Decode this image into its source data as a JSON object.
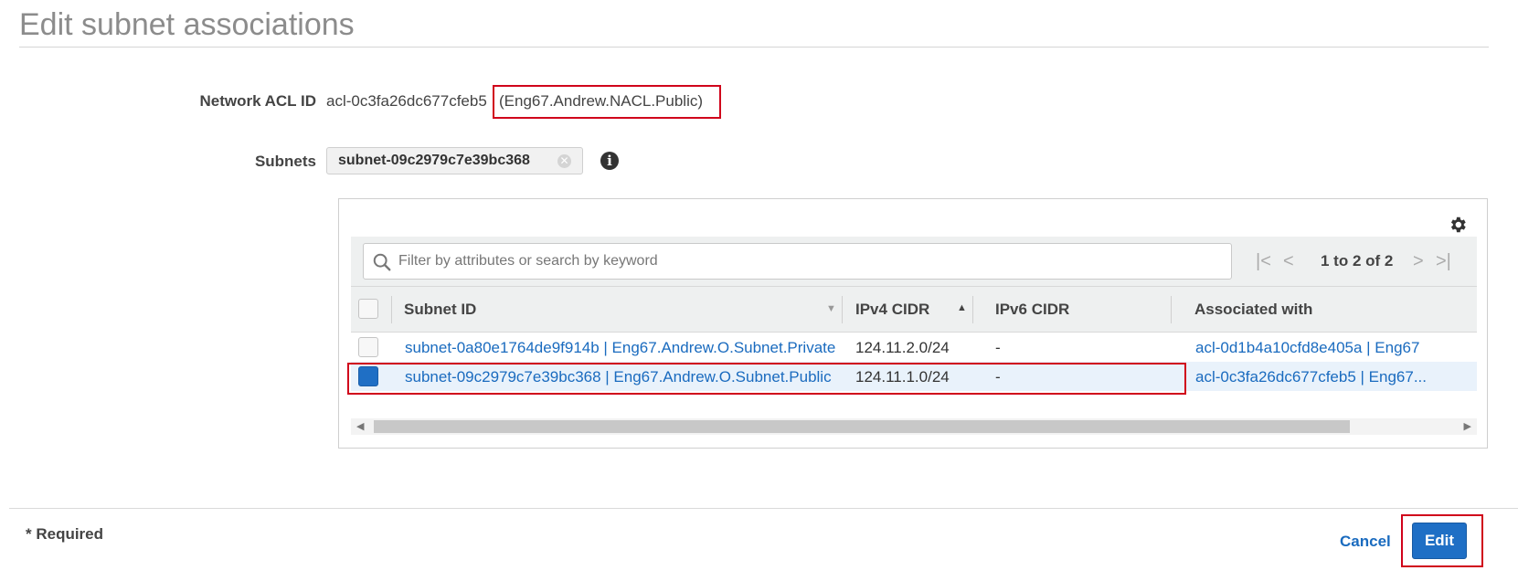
{
  "page": {
    "title": "Edit subnet associations"
  },
  "form": {
    "acl_label": "Network ACL ID",
    "acl_id": "acl-0c3fa26dc677cfeb5",
    "acl_name": "(Eng67.Andrew.NACL.Public)",
    "subnets_label": "Subnets",
    "selected_token": "subnet-09c2979c7e39bc368"
  },
  "table": {
    "search_placeholder": "Filter by attributes or search by keyword",
    "pager_text": "1 to 2 of 2",
    "columns": [
      "Subnet ID",
      "IPv4 CIDR",
      "IPv6 CIDR",
      "Associated with"
    ],
    "rows": [
      {
        "checked": false,
        "subnet": "subnet-0a80e1764de9f914b | Eng67.Andrew.O.Subnet.Private",
        "ipv4": "124.11.2.0/24",
        "ipv6": "-",
        "associated": "acl-0d1b4a10cfd8e405a | Eng67"
      },
      {
        "checked": true,
        "subnet": "subnet-09c2979c7e39bc368 | Eng67.Andrew.O.Subnet.Public",
        "ipv4": "124.11.1.0/24",
        "ipv6": "-",
        "associated": "acl-0c3fa26dc677cfeb5 | Eng67..."
      }
    ]
  },
  "footer": {
    "required": "* Required",
    "cancel": "Cancel",
    "edit": "Edit"
  },
  "colors": {
    "accent": "#1f6fc5",
    "link": "#1a6bbf",
    "highlight_box": "#d0021b"
  }
}
